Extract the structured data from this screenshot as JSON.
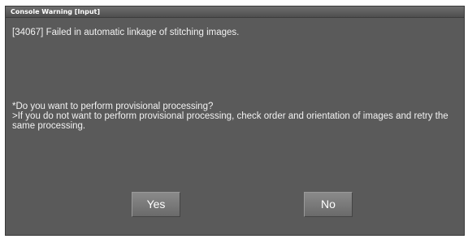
{
  "window": {
    "title": "Console Warning [Input]"
  },
  "message": {
    "error": "[34067] Failed in automatic linkage of stitching images.",
    "question": "*Do you want to perform provisional processing?",
    "detail": ">If you do not want to perform provisional processing, check order and orientation of images and retry the same processing."
  },
  "buttons": {
    "yes_label": "Yes",
    "no_label": "No"
  },
  "colors": {
    "dialog_bg": "#5a5a5a",
    "text": "#f2f2f2",
    "button_bg": "#7a7a7a"
  }
}
